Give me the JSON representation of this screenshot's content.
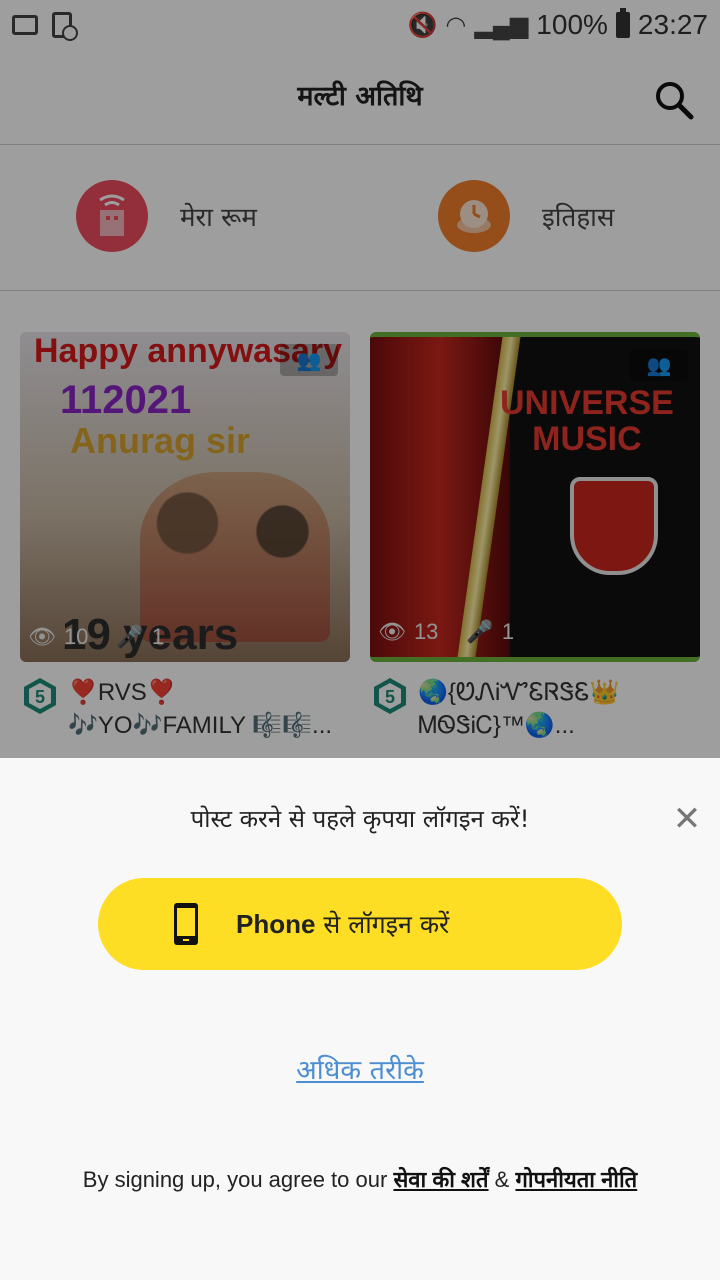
{
  "status_bar": {
    "battery": "100%",
    "time": "23:27"
  },
  "header": {
    "title": "मल्टी अतिथि"
  },
  "quick_actions": [
    {
      "label": "मेरा रूम",
      "color": "#ee4b5f"
    },
    {
      "label": "इतिहास",
      "color": "#f07c2a"
    }
  ],
  "cards": [
    {
      "cover_lines": [
        "Happy annywasary",
        "112021",
        "Anurag sir",
        "19 years"
      ],
      "views": "10",
      "mics": "1",
      "level": "5",
      "name": "❣️RVS❣️ 🎶YO🎶FAMILY 🎼🎼..."
    },
    {
      "cover_lines": [
        "UNIVERSE",
        "MUSIC"
      ],
      "views": "13",
      "mics": "1",
      "level": "5",
      "name": "🌏{ᏬᏁᎥᏉᏋᏒᏕᏋ👑 ᎷᏫᏕᎥᏟ}™🌏..."
    }
  ],
  "login_sheet": {
    "message": "पोस्ट करने से पहले कृपया लॉगइन करें!",
    "phone_button_bold": "Phone",
    "phone_button_rest": " से लॉगइन करें",
    "more_ways": "अधिक तरीके",
    "terms_prefix": "By signing up, you agree to our ",
    "terms_link": "सेवा की शर्तें",
    "terms_and": " & ",
    "privacy_link": "गोपनीयता नीति",
    "button_color": "#fedd25"
  }
}
